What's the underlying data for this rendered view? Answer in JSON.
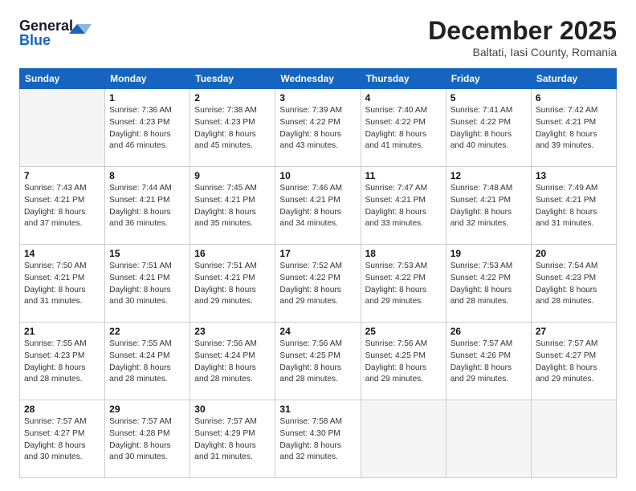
{
  "header": {
    "logo_line1": "General",
    "logo_line2": "Blue",
    "month": "December 2025",
    "location": "Baltati, Iasi County, Romania"
  },
  "weekdays": [
    "Sunday",
    "Monday",
    "Tuesday",
    "Wednesday",
    "Thursday",
    "Friday",
    "Saturday"
  ],
  "weeks": [
    [
      {
        "day": "",
        "info": ""
      },
      {
        "day": "1",
        "info": "Sunrise: 7:36 AM\nSunset: 4:23 PM\nDaylight: 8 hours\nand 46 minutes."
      },
      {
        "day": "2",
        "info": "Sunrise: 7:38 AM\nSunset: 4:23 PM\nDaylight: 8 hours\nand 45 minutes."
      },
      {
        "day": "3",
        "info": "Sunrise: 7:39 AM\nSunset: 4:22 PM\nDaylight: 8 hours\nand 43 minutes."
      },
      {
        "day": "4",
        "info": "Sunrise: 7:40 AM\nSunset: 4:22 PM\nDaylight: 8 hours\nand 41 minutes."
      },
      {
        "day": "5",
        "info": "Sunrise: 7:41 AM\nSunset: 4:22 PM\nDaylight: 8 hours\nand 40 minutes."
      },
      {
        "day": "6",
        "info": "Sunrise: 7:42 AM\nSunset: 4:21 PM\nDaylight: 8 hours\nand 39 minutes."
      }
    ],
    [
      {
        "day": "7",
        "info": "Sunrise: 7:43 AM\nSunset: 4:21 PM\nDaylight: 8 hours\nand 37 minutes."
      },
      {
        "day": "8",
        "info": "Sunrise: 7:44 AM\nSunset: 4:21 PM\nDaylight: 8 hours\nand 36 minutes."
      },
      {
        "day": "9",
        "info": "Sunrise: 7:45 AM\nSunset: 4:21 PM\nDaylight: 8 hours\nand 35 minutes."
      },
      {
        "day": "10",
        "info": "Sunrise: 7:46 AM\nSunset: 4:21 PM\nDaylight: 8 hours\nand 34 minutes."
      },
      {
        "day": "11",
        "info": "Sunrise: 7:47 AM\nSunset: 4:21 PM\nDaylight: 8 hours\nand 33 minutes."
      },
      {
        "day": "12",
        "info": "Sunrise: 7:48 AM\nSunset: 4:21 PM\nDaylight: 8 hours\nand 32 minutes."
      },
      {
        "day": "13",
        "info": "Sunrise: 7:49 AM\nSunset: 4:21 PM\nDaylight: 8 hours\nand 31 minutes."
      }
    ],
    [
      {
        "day": "14",
        "info": "Sunrise: 7:50 AM\nSunset: 4:21 PM\nDaylight: 8 hours\nand 31 minutes."
      },
      {
        "day": "15",
        "info": "Sunrise: 7:51 AM\nSunset: 4:21 PM\nDaylight: 8 hours\nand 30 minutes."
      },
      {
        "day": "16",
        "info": "Sunrise: 7:51 AM\nSunset: 4:21 PM\nDaylight: 8 hours\nand 29 minutes."
      },
      {
        "day": "17",
        "info": "Sunrise: 7:52 AM\nSunset: 4:22 PM\nDaylight: 8 hours\nand 29 minutes."
      },
      {
        "day": "18",
        "info": "Sunrise: 7:53 AM\nSunset: 4:22 PM\nDaylight: 8 hours\nand 29 minutes."
      },
      {
        "day": "19",
        "info": "Sunrise: 7:53 AM\nSunset: 4:22 PM\nDaylight: 8 hours\nand 28 minutes."
      },
      {
        "day": "20",
        "info": "Sunrise: 7:54 AM\nSunset: 4:23 PM\nDaylight: 8 hours\nand 28 minutes."
      }
    ],
    [
      {
        "day": "21",
        "info": "Sunrise: 7:55 AM\nSunset: 4:23 PM\nDaylight: 8 hours\nand 28 minutes."
      },
      {
        "day": "22",
        "info": "Sunrise: 7:55 AM\nSunset: 4:24 PM\nDaylight: 8 hours\nand 28 minutes."
      },
      {
        "day": "23",
        "info": "Sunrise: 7:56 AM\nSunset: 4:24 PM\nDaylight: 8 hours\nand 28 minutes."
      },
      {
        "day": "24",
        "info": "Sunrise: 7:56 AM\nSunset: 4:25 PM\nDaylight: 8 hours\nand 28 minutes."
      },
      {
        "day": "25",
        "info": "Sunrise: 7:56 AM\nSunset: 4:25 PM\nDaylight: 8 hours\nand 29 minutes."
      },
      {
        "day": "26",
        "info": "Sunrise: 7:57 AM\nSunset: 4:26 PM\nDaylight: 8 hours\nand 29 minutes."
      },
      {
        "day": "27",
        "info": "Sunrise: 7:57 AM\nSunset: 4:27 PM\nDaylight: 8 hours\nand 29 minutes."
      }
    ],
    [
      {
        "day": "28",
        "info": "Sunrise: 7:57 AM\nSunset: 4:27 PM\nDaylight: 8 hours\nand 30 minutes."
      },
      {
        "day": "29",
        "info": "Sunrise: 7:57 AM\nSunset: 4:28 PM\nDaylight: 8 hours\nand 30 minutes."
      },
      {
        "day": "30",
        "info": "Sunrise: 7:57 AM\nSunset: 4:29 PM\nDaylight: 8 hours\nand 31 minutes."
      },
      {
        "day": "31",
        "info": "Sunrise: 7:58 AM\nSunset: 4:30 PM\nDaylight: 8 hours\nand 32 minutes."
      },
      {
        "day": "",
        "info": ""
      },
      {
        "day": "",
        "info": ""
      },
      {
        "day": "",
        "info": ""
      }
    ]
  ]
}
